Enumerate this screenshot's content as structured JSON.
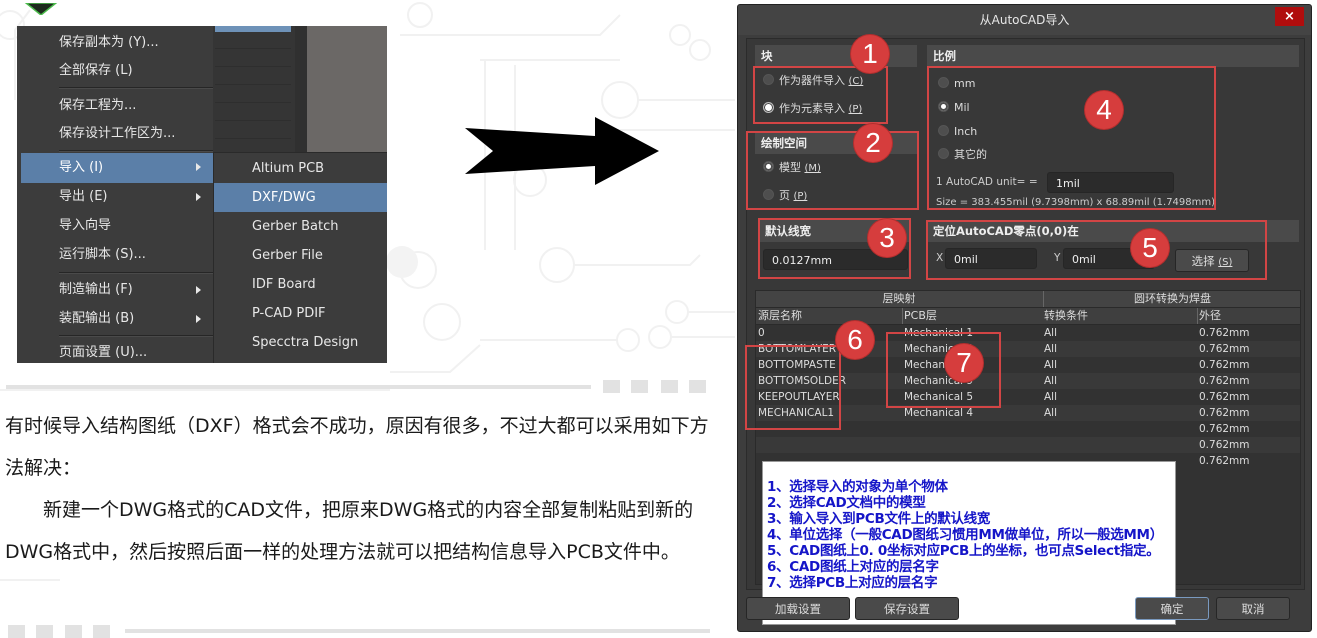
{
  "menu": {
    "items": [
      {
        "label": "保存副本为 (Y)...",
        "active": false,
        "submenu": false
      },
      {
        "label": "全部保存 (L)",
        "active": false,
        "submenu": false
      },
      {
        "label": "保存工程为...",
        "active": false,
        "submenu": false
      },
      {
        "label": "保存设计工作区为...",
        "active": false,
        "submenu": false
      },
      {
        "label": "导入 (I)",
        "active": true,
        "submenu": true
      },
      {
        "label": "导出 (E)",
        "active": false,
        "submenu": true
      },
      {
        "label": "导入向导",
        "active": false,
        "submenu": false
      },
      {
        "label": "运行脚本 (S)...",
        "active": false,
        "submenu": false
      },
      {
        "label": "制造输出 (F)",
        "active": false,
        "submenu": true
      },
      {
        "label": "装配输出 (B)",
        "active": false,
        "submenu": true
      },
      {
        "label": "页面设置 (U)...",
        "active": false,
        "submenu": false
      }
    ],
    "submenu_items": [
      {
        "label": "Altium PCB",
        "active": false
      },
      {
        "label": "DXF/DWG",
        "active": true
      },
      {
        "label": "Gerber Batch",
        "active": false
      },
      {
        "label": "Gerber File",
        "active": false
      },
      {
        "label": "IDF Board",
        "active": false
      },
      {
        "label": "P-CAD PDIF",
        "active": false
      },
      {
        "label": "Specctra Design",
        "active": false
      }
    ]
  },
  "article": {
    "paragraph1": "有时候导入结构图纸（DXF）格式会不成功，原因有很多，不过大都可以采用如下方法解决：",
    "paragraph2": "新建一个DWG格式的CAD文件，把原来DWG格式的内容全部复制粘贴到新的DWG格式中，然后按照后面一样的处理方法就可以把结构信息导入PCB文件中。"
  },
  "dialog": {
    "title": "从AutoCAD导入",
    "close_label": "×",
    "block": {
      "heading": "块",
      "options": [
        {
          "label": "作为器件导入",
          "key": "(C)",
          "selected": false
        },
        {
          "label": "作为元素导入",
          "key": "(P)",
          "selected": true
        }
      ]
    },
    "draw_space": {
      "heading": "绘制空间",
      "options": [
        {
          "label": "模型",
          "key": "(M)",
          "selected": true
        },
        {
          "label": "页",
          "key": "(P)",
          "selected": false
        }
      ]
    },
    "scale": {
      "heading": "比例",
      "options": [
        {
          "label": "mm",
          "selected": false
        },
        {
          "label": "Mil",
          "selected": true
        },
        {
          "label": "Inch",
          "selected": false
        },
        {
          "label": "其它的",
          "selected": false
        }
      ],
      "unit_label": "1 AutoCAD unit= =",
      "unit_value": "1mil",
      "size_text": "Size = 383.455mil (9.7398mm) x 68.89mil (1.7498mm)"
    },
    "line_width": {
      "heading": "默认线宽",
      "value": "0.0127mm"
    },
    "origin": {
      "heading": "定位AutoCAD零点(0,0)在",
      "x_label": "X",
      "x_value": "0mil",
      "y_label": "Y",
      "y_value": "0mil",
      "select_label": "选择",
      "select_key": "(S)"
    },
    "table": {
      "group_headers": [
        "层映射",
        "圆环转换为焊盘"
      ],
      "columns": [
        "源层名称",
        "PCB层",
        "转换条件",
        "外径"
      ],
      "rows": [
        [
          "0",
          "Mechanical 1",
          "All",
          "0.762mm"
        ],
        [
          "BOTTOMLAYER",
          "Mechanical 3",
          "All",
          "0.762mm"
        ],
        [
          "BOTTOMPASTE",
          "Mechanical 7",
          "All",
          "0.762mm"
        ],
        [
          "BOTTOMSOLDER",
          "Mechanical 9",
          "All",
          "0.762mm"
        ],
        [
          "KEEPOUTLAYER",
          "Mechanical 5",
          "All",
          "0.762mm"
        ],
        [
          "MECHANICAL1",
          "Mechanical 4",
          "All",
          "0.762mm"
        ],
        [
          "",
          "",
          "",
          "0.762mm"
        ],
        [
          "",
          "",
          "",
          "0.762mm"
        ],
        [
          "",
          "",
          "",
          "0.762mm"
        ]
      ]
    },
    "notes": [
      "1、选择导入的对象为单个物体",
      "2、选择CAD文档中的模型",
      "3、输入导入到PCB文件上的默认线宽",
      "4、单位选择（一般CAD图纸习惯用MM做单位，所以一般选MM）",
      "5、CAD图纸上0. 0坐标对应PCB上的坐标，也可点Select指定。",
      "6、CAD图纸上对应的层名字",
      "7、选择PCB上对应的层名字"
    ],
    "badges": [
      "1",
      "2",
      "3",
      "4",
      "5",
      "6",
      "7"
    ],
    "buttons": {
      "load": "加载设置",
      "save": "保存设置",
      "ok": "确定",
      "cancel": "取消"
    }
  },
  "colors": {
    "menu_highlight": "#5b7fa8",
    "annotation_red": "#d63d3d",
    "notes_text": "#1515c8",
    "close_button": "#b00d0d"
  }
}
